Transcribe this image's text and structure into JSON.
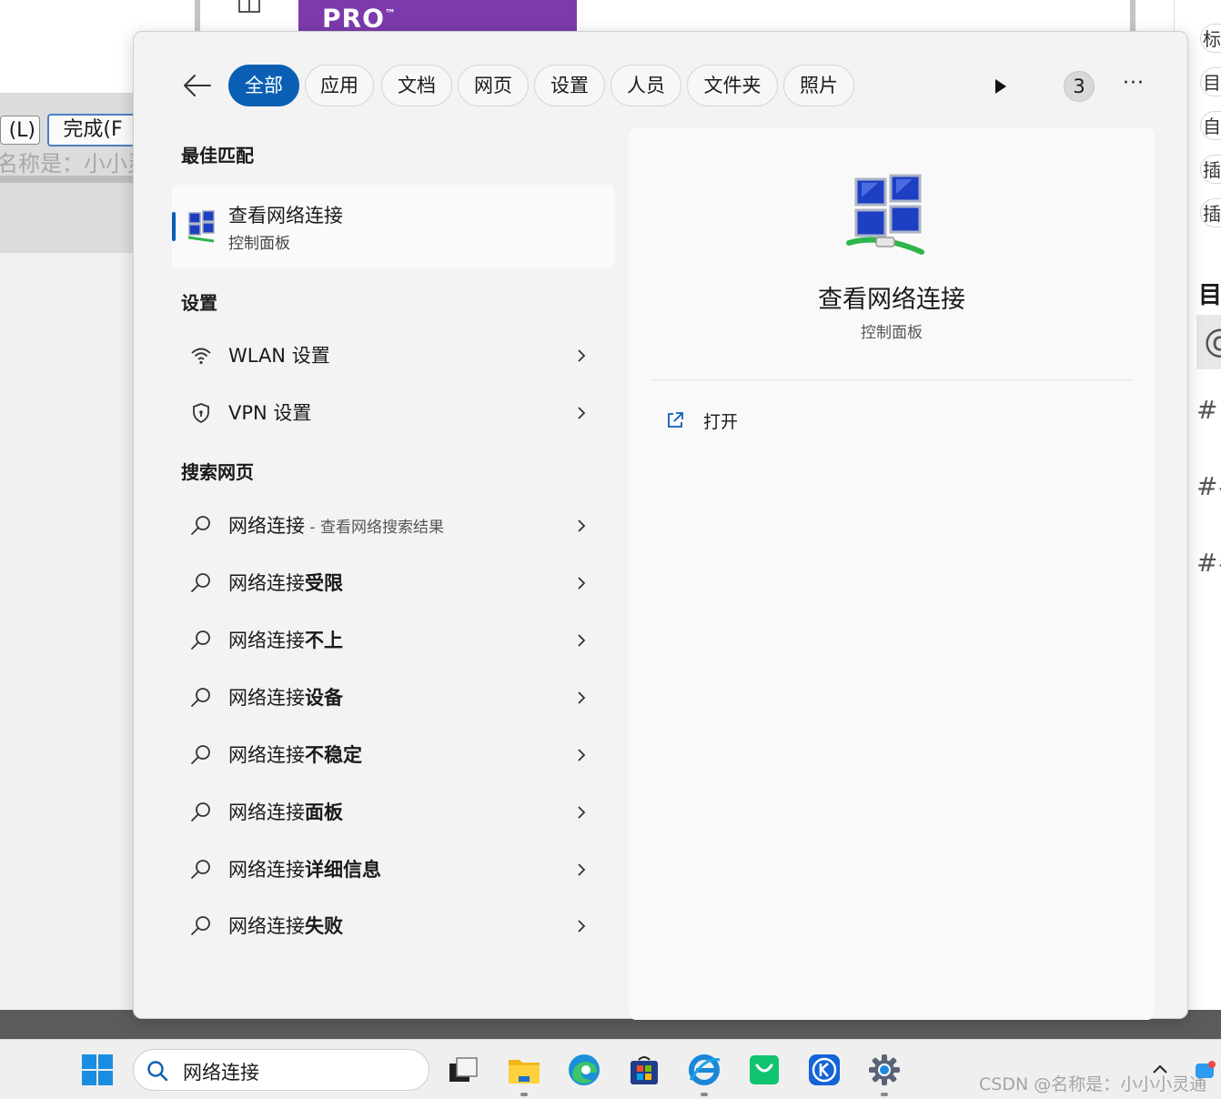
{
  "background": {
    "button_left": "(L)",
    "button_done": "完成(F",
    "name_text": "名称是：小小灵通",
    "pro_label": "PRO",
    "pro_mark": "™",
    "right_pills": [
      "标",
      "目",
      "自",
      "插",
      "插"
    ],
    "right_heading": "目",
    "right_at": "@",
    "right_hashes": [
      "#",
      "##",
      "##"
    ]
  },
  "search_flyout": {
    "tabs": [
      {
        "label": "全部",
        "active": true
      },
      {
        "label": "应用",
        "active": false
      },
      {
        "label": "文档",
        "active": false
      },
      {
        "label": "网页",
        "active": false
      },
      {
        "label": "设置",
        "active": false
      },
      {
        "label": "人员",
        "active": false
      },
      {
        "label": "文件夹",
        "active": false
      },
      {
        "label": "照片",
        "active": false
      }
    ],
    "result_count": "3",
    "more_label": "···",
    "best_match": {
      "heading": "最佳匹配",
      "title": "查看网络连接",
      "subtitle": "控制面板"
    },
    "settings": {
      "heading": "设置",
      "items": [
        {
          "label": "WLAN 设置",
          "icon": "wifi-icon"
        },
        {
          "label": "VPN 设置",
          "icon": "shield-icon"
        }
      ]
    },
    "web": {
      "heading": "搜索网页",
      "first": {
        "prefix": "网络连接",
        "hint": " - 查看网络搜索结果"
      },
      "items": [
        {
          "prefix": "网络连接",
          "bold": "受限"
        },
        {
          "prefix": "网络连接",
          "bold": "不上"
        },
        {
          "prefix": "网络连接",
          "bold": "设备"
        },
        {
          "prefix": "网络连接",
          "bold": "不稳定"
        },
        {
          "prefix": "网络连接",
          "bold": "面板"
        },
        {
          "prefix": "网络连接",
          "bold": "详细信息"
        },
        {
          "prefix": "网络连接",
          "bold": "失败"
        }
      ]
    },
    "preview": {
      "title": "查看网络连接",
      "subtitle": "控制面板",
      "open_label": "打开"
    }
  },
  "taskbar": {
    "search_value": "网络连接",
    "watermark": "CSDN @名称是：小小小灵通"
  },
  "colors": {
    "accent": "#0a5fb4",
    "panel_bg": "#f3f3f3",
    "preview_bg": "#f9f9f9"
  }
}
